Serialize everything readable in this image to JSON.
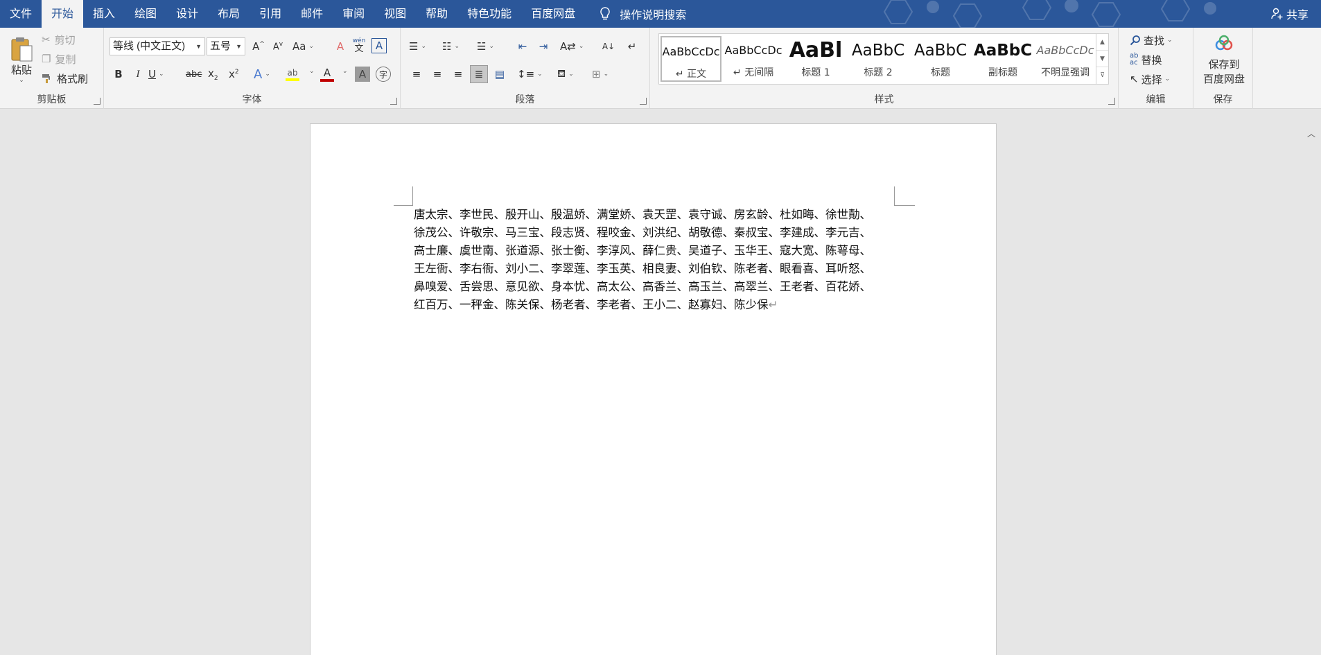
{
  "tabs": [
    "文件",
    "开始",
    "插入",
    "绘图",
    "设计",
    "布局",
    "引用",
    "邮件",
    "审阅",
    "视图",
    "帮助",
    "特色功能",
    "百度网盘"
  ],
  "active_tab": "开始",
  "tell_me": "操作说明搜索",
  "share": "共享",
  "clipboard": {
    "paste": "粘贴",
    "cut": "剪切",
    "copy": "复制",
    "format_painter": "格式刷",
    "label": "剪贴板"
  },
  "font": {
    "name": "等线 (中文正文)",
    "size": "五号",
    "label": "字体",
    "case": "Aa",
    "phonetic": "wén"
  },
  "paragraph": {
    "label": "段落"
  },
  "styles": {
    "label": "样式",
    "items": [
      {
        "preview": "AaBbCcDc",
        "name": "↵ 正文"
      },
      {
        "preview": "AaBbCcDc",
        "name": "↵ 无间隔"
      },
      {
        "preview": "AaBl",
        "name": "标题 1"
      },
      {
        "preview": "AaBbC",
        "name": "标题 2"
      },
      {
        "preview": "AaBbC",
        "name": "标题"
      },
      {
        "preview": "AaBbC",
        "name": "副标题"
      },
      {
        "preview": "AaBbCcDc",
        "name": "不明显强调"
      }
    ]
  },
  "editing": {
    "find": "查找",
    "replace": "替换",
    "select": "选择",
    "label": "编辑"
  },
  "save_group": {
    "button": "保存到百度网盘",
    "line1": "保存到",
    "line2": "百度网盘",
    "label": "保存"
  },
  "document": {
    "lines": [
      "唐太宗、李世民、殷开山、殷温娇、满堂娇、袁天罡、袁守诚、房玄龄、杜如晦、徐世勣、",
      "徐茂公、许敬宗、马三宝、段志贤、程咬金、刘洪纪、胡敬德、秦叔宝、李建成、李元吉、",
      "高士廉、虞世南、张道源、张士衡、李淳风、薛仁贵、吴道子、玉华王、寇大宽、陈萼母、",
      "王左衙、李右衙、刘小二、李翠莲、李玉英、相良妻、刘伯钦、陈老者、眼看喜、耳听怒、",
      "鼻嗅爱、舌尝思、意见欲、身本忧、高太公、高香兰、高玉兰、高翠兰、王老者、百花娇、",
      "红百万、一秤金、陈关保、杨老者、李老者、王小二、赵寡妇、陈少保"
    ],
    "end_mark": "↵"
  },
  "colors": {
    "accent": "#2b579a",
    "highlight": "#ffff00",
    "font_color": "#c00000"
  }
}
